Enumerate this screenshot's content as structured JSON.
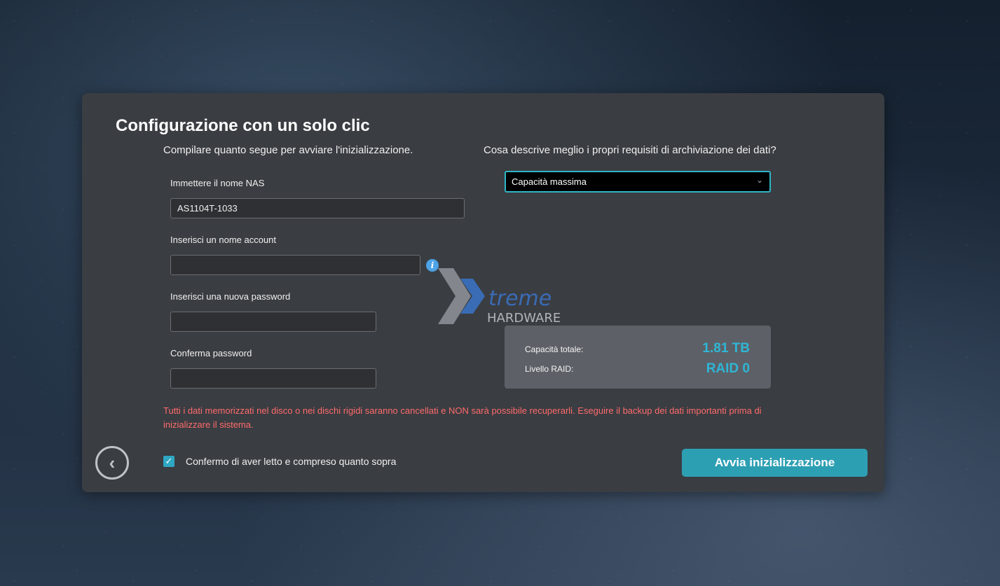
{
  "dialog": {
    "title": "Configurazione con un solo clic",
    "subtitle_left": "Compilare quanto segue per avviare l'inizializzazione.",
    "subtitle_right": "Cosa descrive meglio i propri requisiti di archiviazione dei dati?"
  },
  "form": {
    "nas_name_label": "Immettere il nome NAS",
    "nas_name_value": "AS1104T-1033",
    "account_label": "Inserisci un nome account",
    "account_value": "",
    "password_label": "Inserisci una nuova password",
    "password_value": "",
    "confirm_label": "Conferma password",
    "confirm_value": ""
  },
  "storage": {
    "selected_option": "Capacità massima",
    "total_capacity_label": "Capacità totale:",
    "total_capacity_value": "1.81 TB",
    "raid_label": "Livello RAID:",
    "raid_value": "RAID 0"
  },
  "warning_text": "Tutti i dati memorizzati nel disco o nei dischi rigidi saranno cancellati e NON sarà possibile recuperarli. Eseguire il backup dei dati importanti prima di inizializzare il sistema.",
  "confirm_checkbox": {
    "checked": true,
    "label": "Confermo di aver letto e compreso quanto sopra"
  },
  "buttons": {
    "start_label": "Avvia inizializzazione",
    "back_icon": "chevron-left-icon"
  },
  "watermark": {
    "line1": "treme",
    "line2": "HARDWARE"
  },
  "colors": {
    "accent": "#2d9fb3",
    "value_text": "#2fb6d6",
    "warning": "#ff6b6b",
    "panel": "#3a3d42"
  }
}
